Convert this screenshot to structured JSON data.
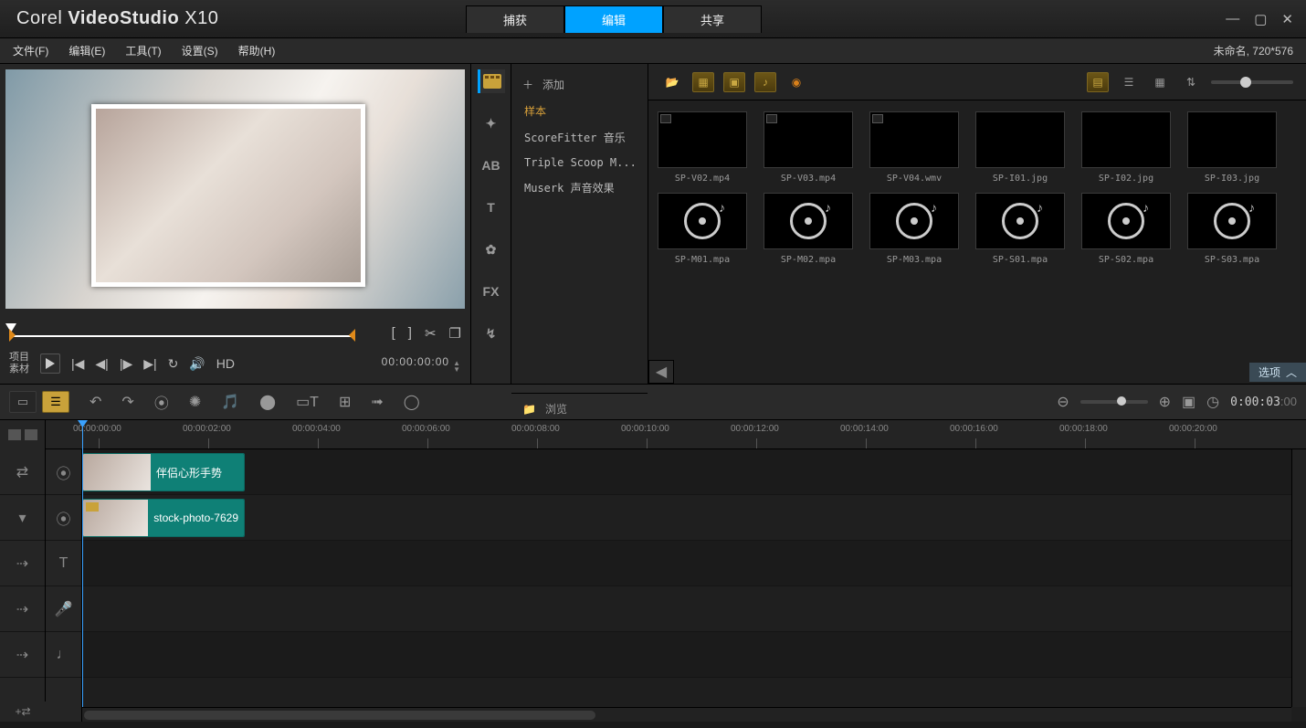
{
  "app": {
    "brand_prefix": "Corel",
    "brand_strong": "VideoStudio",
    "brand_suffix": "X10"
  },
  "tabs": [
    "捕获",
    "编辑",
    "共享"
  ],
  "active_tab": 1,
  "menu": [
    "文件(F)",
    "编辑(E)",
    "工具(T)",
    "设置(S)",
    "帮助(H)"
  ],
  "project_info": "未命名, 720*576",
  "preview": {
    "labels": [
      "项目",
      "素材"
    ],
    "hd": "HD",
    "timecode": "00:00:00:00",
    "tool_icons": {
      "mark_in": "[",
      "mark_out": "]",
      "cut": "✂",
      "multi": "❐"
    }
  },
  "library": {
    "add_label": "添加",
    "categories": [
      "样本",
      "ScoreFitter 音乐",
      "Triple Scoop M...",
      "Muserk 声音效果"
    ],
    "active_category": 0,
    "browse_label": "浏览",
    "options_label": "选项",
    "items_row1": [
      {
        "name": "SP-V02.mp4",
        "bg": "bg-purple",
        "tagged": true
      },
      {
        "name": "SP-V03.mp4",
        "bg": "bg-cream",
        "tagged": true
      },
      {
        "name": "SP-V04.wmv",
        "bg": "bg-blue",
        "tagged": true
      },
      {
        "name": "SP-I01.jpg",
        "bg": "bg-flower",
        "tagged": false
      },
      {
        "name": "SP-I02.jpg",
        "bg": "bg-trees",
        "tagged": false
      },
      {
        "name": "SP-I03.jpg",
        "bg": "bg-desert",
        "tagged": false
      }
    ],
    "items_row2": [
      {
        "name": "SP-M01.mpa"
      },
      {
        "name": "SP-M02.mpa"
      },
      {
        "name": "SP-M03.mpa"
      },
      {
        "name": "SP-S01.mpa"
      },
      {
        "name": "SP-S02.mpa"
      },
      {
        "name": "SP-S03.mpa"
      }
    ]
  },
  "timeline": {
    "timecode": "0:00:03:00",
    "ruler": [
      "00:00:00:00",
      "00:00:02:00",
      "00:00:04:00",
      "00:00:06:00",
      "00:00:08:00",
      "00:00:10:00",
      "00:00:12:00",
      "00:00:14:00",
      "00:00:16:00",
      "00:00:18:00",
      "00:00:20:00"
    ],
    "clips": [
      {
        "lane": 0,
        "left": 0,
        "width": 178,
        "title": "伴侣心形手势"
      },
      {
        "lane": 1,
        "left": 0,
        "width": 178,
        "title": "stock-photo-7629"
      }
    ]
  }
}
